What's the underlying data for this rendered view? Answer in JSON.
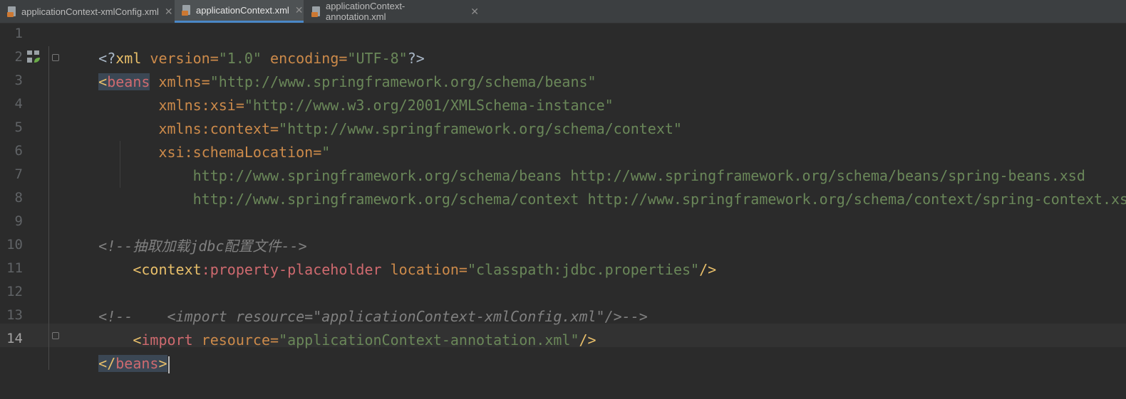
{
  "tabs": [
    {
      "label": "applicationContext-xmlConfig.xml",
      "active": false
    },
    {
      "label": "applicationContext.xml",
      "active": true
    },
    {
      "label": "applicationContext-annotation.xml",
      "active": false
    }
  ],
  "line_numbers": [
    "1",
    "2",
    "3",
    "4",
    "5",
    "6",
    "7",
    "8",
    "9",
    "10",
    "11",
    "12",
    "13",
    "14"
  ],
  "code": {
    "l1_open": "<?",
    "l1_xml": "xml",
    "l1_version_attr": " version=",
    "l1_version_val": "\"1.0\"",
    "l1_enc_attr": " encoding=",
    "l1_enc_val": "\"UTF-8\"",
    "l1_close": "?>",
    "l2_lt": "<",
    "l2_tag": "beans",
    "l2_attr": " xmlns=",
    "l2_val": "\"http://www.springframework.org/schema/beans\"",
    "l3_attr": "xmlns:xsi=",
    "l3_val": "\"http://www.w3.org/2001/XMLSchema-instance\"",
    "l4_attr": "xmlns:context=",
    "l4_val": "\"http://www.springframework.org/schema/context\"",
    "l5_attr": "xsi:schemaLocation=",
    "l5_val": "\"",
    "l6_val": "http://www.springframework.org/schema/beans http://www.springframework.org/schema/beans/spring-beans.xsd",
    "l7_val": "http://www.springframework.org/schema/context http://www.springframework.org/schema/context/spring-context.xsd\"",
    "l7_close": ">",
    "l9_comment": "<!--抽取加载jdbc配置文件-->",
    "l10_lt": "<",
    "l10_ns": "context",
    "l10_tag": ":property-placeholder",
    "l10_attr": " location=",
    "l10_val": "\"classpath:jdbc.properties\"",
    "l10_close": "/>",
    "l12_comment": "<!--    <import resource=\"applicationContext-xmlConfig.xml\"/>-->",
    "l13_lt": "<",
    "l13_tag": "import",
    "l13_attr": " resource=",
    "l13_val": "\"applicationContext-annotation.xml\"",
    "l13_close": "/>",
    "l14_lt": "</",
    "l14_tag": "beans",
    "l14_gt": ">"
  },
  "icons": [
    "xml-file-icon",
    "close-icon",
    "spring-bean-icon",
    "fold-icon"
  ]
}
